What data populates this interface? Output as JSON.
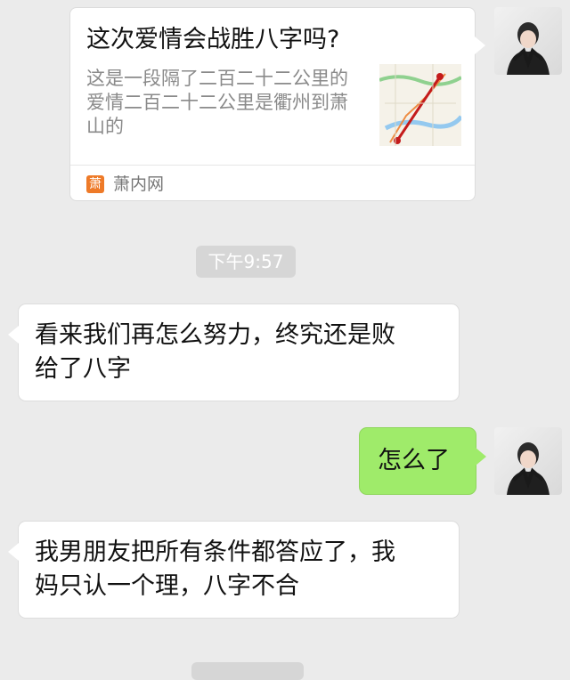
{
  "card": {
    "title": "这次爱情会战胜八字吗?",
    "description": "这是一段隔了二百二十二公里的爱情二百二十二公里是衢州到萧山的",
    "source_icon_text": "萧",
    "source_name": "萧内网",
    "thumbnail_icon": "map-thumbnail"
  },
  "timestamps": [
    {
      "text": "下午9:57"
    }
  ],
  "messages": [
    {
      "side": "left",
      "text": "看来我们再怎么努力，终究还是败\n给了八字"
    },
    {
      "side": "right",
      "text": "怎么了"
    },
    {
      "side": "left",
      "text": "我男朋友把所有条件都答应了，我\n妈只认一个理，八字不合"
    }
  ],
  "colors": {
    "background": "#ebebeb",
    "bubble_left": "#ffffff",
    "bubble_right": "#9feb6a",
    "timestamp_bg": "#d6d6d6",
    "source_icon": "#ee7a28"
  }
}
